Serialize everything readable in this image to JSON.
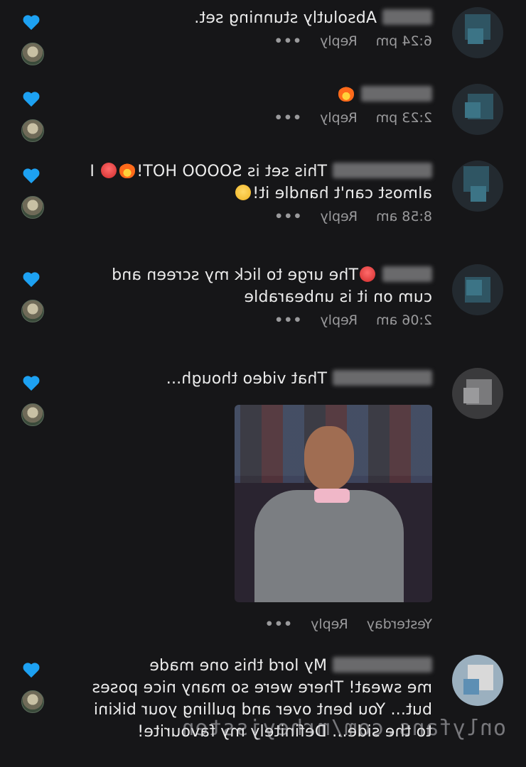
{
  "comments": [
    {
      "lines": [
        "Absolutly stunning set."
      ],
      "time": "6:24 pm",
      "reply": "Reply",
      "more": "•••"
    },
    {
      "lines": [
        ""
      ],
      "time": "2:23 pm",
      "reply": "Reply",
      "more": "•••"
    },
    {
      "lines": [
        "This set is SOOOO HOT!",
        "almost can't handle it!"
      ],
      "line1_suffix": "I",
      "time": "8:58 am",
      "reply": "Reply",
      "more": "•••"
    },
    {
      "lines": [
        "The urge to lick my screen and",
        "cum on it is unbearable"
      ],
      "time": "2:06 am",
      "reply": "Reply",
      "more": "•••"
    },
    {
      "lines": [
        "That video though..."
      ],
      "time": "Yesterday",
      "reply": "Reply",
      "more": "•••"
    },
    {
      "lines": [
        "My lord this one made",
        "me sweat! There were so many nice poses",
        "but... You bent over and pulling your bikini",
        "to the side... Definitely my favourite!"
      ]
    }
  ],
  "watermark": "onlyfans.com/mrheyjssten",
  "colors": {
    "heart": "#1da1f2",
    "bg": "#161618"
  }
}
